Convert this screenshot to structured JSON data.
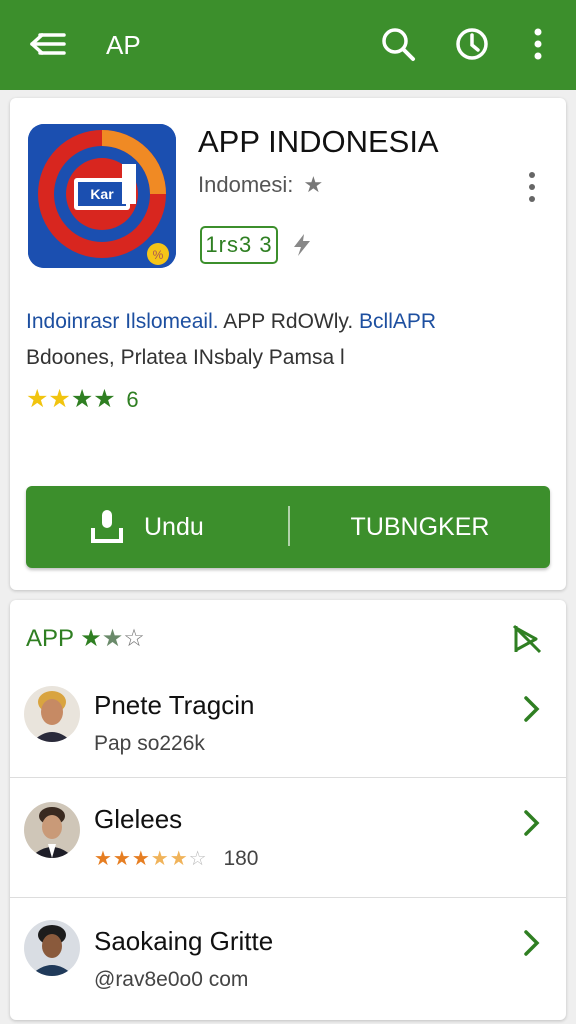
{
  "appbar": {
    "title": "AP",
    "icons": [
      "menu-back-icon",
      "search-icon",
      "history-icon",
      "more-vert-icon"
    ]
  },
  "app": {
    "name": "APP INDONESIA",
    "developer": "Indomesi:",
    "developer_star": "★",
    "age_badge": "1rs3 3",
    "icon_text": "Kar",
    "description_line1_blue1": "Indoinrasr Ilslomeail.",
    "description_line1_mid": " APP RdOWly. ",
    "description_line1_blue2": "BcllAPR",
    "description_line2": "Bdoones, Prlatea  INsbaly Pamsa l",
    "rating_stars": "★★★★",
    "rating_value": "6"
  },
  "actions": {
    "download_label": "Undu",
    "secondary_label": "TUBNGKER"
  },
  "reviews_section": {
    "title": "APP",
    "stars_full": "★",
    "stars_gray": "★",
    "stars_empty": "☆",
    "items": [
      {
        "name": "Pnete Tragcin",
        "sub": "Pap so226k"
      },
      {
        "name": "Glelees",
        "stars": "★★★",
        "stars_half": "★★",
        "stars_empty": "☆",
        "count": "180"
      },
      {
        "name": "Saokaing Gritte",
        "sub": "@rav8e0o0 com"
      }
    ]
  },
  "colors": {
    "primary": "#3c8f2c",
    "accent_blue": "#1d4fa0",
    "star_yellow": "#f1c40f",
    "star_orange": "#e67e22"
  }
}
